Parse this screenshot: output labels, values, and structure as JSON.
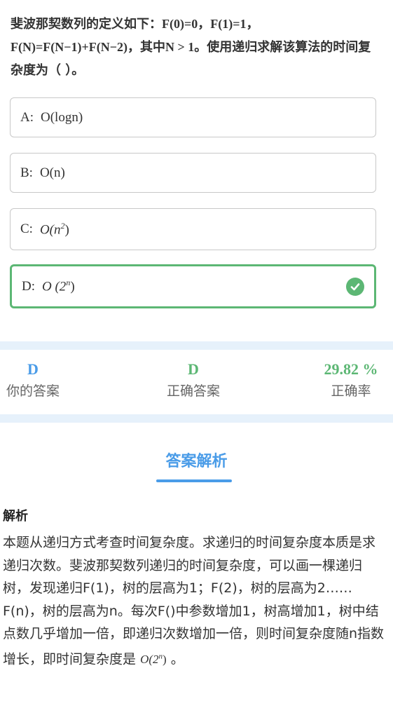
{
  "question": {
    "prefix": "斐波那契数列的定义如下：",
    "formula1": "F(0)=0，F(1)=1，F(N)=F(N−1)+F(N−2)",
    "middle": "，其中",
    "formula2": "N > 1",
    "suffix": "。使用递归求解该算法的时间复杂度为（ ）。"
  },
  "options": [
    {
      "letter": "A:",
      "text": "O(logn)"
    },
    {
      "letter": "B:",
      "text": "O(n)"
    },
    {
      "letter": "C:",
      "base": "O(n",
      "exp": "2",
      "close": ")"
    },
    {
      "letter": "D:",
      "base": "O (2",
      "exp": "n",
      "close": ")"
    }
  ],
  "stats": {
    "your_answer": {
      "value": "D",
      "label": "你的答案"
    },
    "correct_answer": {
      "value": "D",
      "label": "正确答案"
    },
    "accuracy": {
      "value": "29.82 %",
      "label": "正确率"
    }
  },
  "tab": {
    "title": "答案解析"
  },
  "analysis": {
    "heading": "解析",
    "body": "本题从递归方式考查时间复杂度。求递归的时间复杂度本质是求递归次数。斐波那契数列递归的时间复杂度，可以画一棵递归树，发现递归F(1)，树的层高为1；F(2)，树的层高为2……F(n)，树的层高为n。每次F()中参数增加1，树高增加1，树中结点数几乎增加一倍，即递归次数增加一倍，则时间复杂度随n指数增长，即时间复杂度是",
    "formula_base": "O(2",
    "formula_exp": "n",
    "formula_close": ")",
    "end": "。"
  },
  "colors": {
    "correct": "#5cb774",
    "accent": "#4a9ce8",
    "band": "#e6f1fb"
  },
  "icons": {
    "correct_mark": "check-circle-icon"
  }
}
